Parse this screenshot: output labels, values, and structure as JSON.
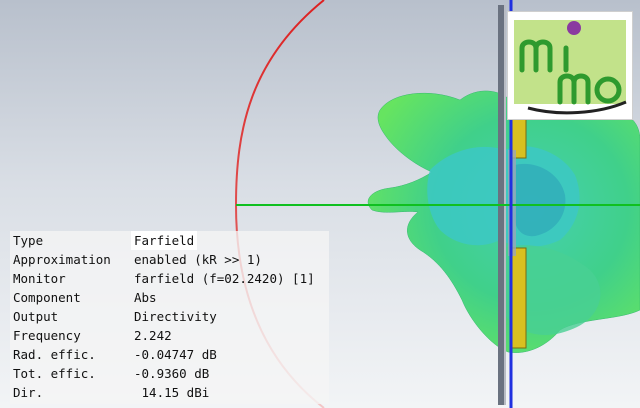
{
  "logo": {
    "text": "mimo"
  },
  "farfield": {
    "rows": [
      {
        "label": "Type",
        "value": "Farfield"
      },
      {
        "label": "Approximation",
        "value": "enabled (kR >> 1)"
      },
      {
        "label": "Monitor",
        "value": "farfield (f=02.2420) [1]"
      },
      {
        "label": "Component",
        "value": "Abs"
      },
      {
        "label": "Output",
        "value": "Directivity"
      },
      {
        "label": "Frequency",
        "value": "2.242"
      },
      {
        "label": "Rad. effic.",
        "value": "-0.04747 dB"
      },
      {
        "label": "Tot. effic.",
        "value": "-0.9360 dB"
      },
      {
        "label": "Dir.",
        "value": " 14.15 dBi"
      }
    ]
  },
  "colors": {
    "pattern_dark": "#3ccc7a",
    "pattern_light": "#59e06b",
    "pattern_cyan": "#3cc7c8",
    "axis_green": "#10c020",
    "axis_blue": "#2030e0",
    "circle_red": "#dd2020",
    "board_yellow": "#d8c020",
    "logo_green": "#2e9a2e",
    "logo_bg": "#c2e28a",
    "logo_dot": "#8a3aa0"
  }
}
